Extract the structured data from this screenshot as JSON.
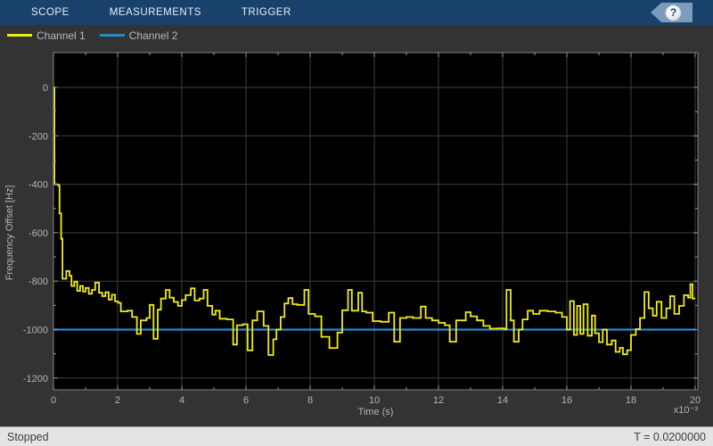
{
  "toolbar": {
    "tabs": [
      {
        "id": "scope",
        "label": "SCOPE"
      },
      {
        "id": "measurements",
        "label": "MEASUREMENTS"
      },
      {
        "id": "trigger",
        "label": "TRIGGER"
      }
    ],
    "help_glyph": "?"
  },
  "legend": {
    "items": [
      {
        "label": "Channel 1",
        "color": "#f1ec16"
      },
      {
        "label": "Channel 2",
        "color": "#2a86cc"
      }
    ]
  },
  "status_bar": {
    "state": "Stopped",
    "time_display": "T = 0.0200000"
  },
  "colors": {
    "toolbar_bg": "#18426b",
    "panel_bg": "#333333",
    "plot_bg": "#000000",
    "grid": "#3e3e3e",
    "axes_box": "#828282",
    "tick": "#9a9a9a",
    "text": "#b4b4b4",
    "channel1": "#f1ec16",
    "channel2": "#2a86cc",
    "status_bg": "#e4e4e4"
  },
  "chart_data": {
    "type": "line",
    "title": "",
    "xlabel": "Time (s)",
    "ylabel": "Frequency Offset [Hz]",
    "x_multiplier_label": "x10⁻³",
    "x_unit_scale": 0.001,
    "xlim_ms": [
      0,
      20
    ],
    "ylim": [
      -1250,
      145
    ],
    "x_major_ticks_ms": [
      0,
      2,
      4,
      6,
      8,
      10,
      12,
      14,
      16,
      18,
      20
    ],
    "x_minor_ticks_ms": [
      1,
      3,
      5,
      7,
      9,
      11,
      13,
      15,
      17,
      19
    ],
    "y_major_ticks": [
      0,
      -200,
      -400,
      -600,
      -800,
      -1000,
      -1200
    ],
    "y_minor_ticks": [
      -100,
      -300,
      -500,
      -700,
      -900,
      -1100
    ],
    "grid": true,
    "legend_position": "top-left",
    "series": [
      {
        "name": "Channel 1",
        "color": "#f1ec16",
        "style": "steps-post",
        "points_t_ms_hz": [
          [
            0,
            0
          ],
          [
            0.03,
            -400
          ],
          [
            0.15,
            -405
          ],
          [
            0.19,
            -520
          ],
          [
            0.24,
            -625
          ],
          [
            0.28,
            -790
          ],
          [
            0.4,
            -758
          ],
          [
            0.5,
            -778
          ],
          [
            0.56,
            -820
          ],
          [
            0.65,
            -802
          ],
          [
            0.74,
            -840
          ],
          [
            0.83,
            -820
          ],
          [
            0.92,
            -843
          ],
          [
            1.0,
            -828
          ],
          [
            1.1,
            -852
          ],
          [
            1.2,
            -836
          ],
          [
            1.3,
            -806
          ],
          [
            1.42,
            -848
          ],
          [
            1.52,
            -862
          ],
          [
            1.62,
            -846
          ],
          [
            1.72,
            -876
          ],
          [
            1.82,
            -856
          ],
          [
            1.92,
            -884
          ],
          [
            2.02,
            -890
          ],
          [
            2.1,
            -925
          ],
          [
            2.3,
            -922
          ],
          [
            2.45,
            -948
          ],
          [
            2.6,
            -1018
          ],
          [
            2.72,
            -962
          ],
          [
            2.9,
            -952
          ],
          [
            3.0,
            -898
          ],
          [
            3.12,
            -1038
          ],
          [
            3.25,
            -918
          ],
          [
            3.35,
            -872
          ],
          [
            3.5,
            -836
          ],
          [
            3.62,
            -868
          ],
          [
            3.75,
            -886
          ],
          [
            3.88,
            -902
          ],
          [
            4.0,
            -878
          ],
          [
            4.12,
            -858
          ],
          [
            4.28,
            -830
          ],
          [
            4.4,
            -880
          ],
          [
            4.55,
            -872
          ],
          [
            4.68,
            -836
          ],
          [
            4.8,
            -902
          ],
          [
            4.95,
            -938
          ],
          [
            5.05,
            -922
          ],
          [
            5.18,
            -955
          ],
          [
            5.4,
            -958
          ],
          [
            5.6,
            -1062
          ],
          [
            5.72,
            -982
          ],
          [
            5.9,
            -978
          ],
          [
            6.05,
            -1086
          ],
          [
            6.2,
            -962
          ],
          [
            6.35,
            -925
          ],
          [
            6.55,
            -985
          ],
          [
            6.7,
            -1105
          ],
          [
            6.85,
            -1040
          ],
          [
            6.95,
            -1000
          ],
          [
            7.08,
            -948
          ],
          [
            7.2,
            -892
          ],
          [
            7.32,
            -870
          ],
          [
            7.45,
            -895
          ],
          [
            7.6,
            -898
          ],
          [
            7.82,
            -836
          ],
          [
            7.95,
            -935
          ],
          [
            8.15,
            -945
          ],
          [
            8.35,
            -1030
          ],
          [
            8.6,
            -1076
          ],
          [
            8.85,
            -1012
          ],
          [
            9.0,
            -920
          ],
          [
            9.18,
            -836
          ],
          [
            9.3,
            -922
          ],
          [
            9.5,
            -848
          ],
          [
            9.62,
            -925
          ],
          [
            9.75,
            -930
          ],
          [
            9.95,
            -965
          ],
          [
            10.2,
            -968
          ],
          [
            10.45,
            -930
          ],
          [
            10.62,
            -1050
          ],
          [
            10.8,
            -952
          ],
          [
            11.0,
            -948
          ],
          [
            11.2,
            -952
          ],
          [
            11.45,
            -905
          ],
          [
            11.6,
            -952
          ],
          [
            11.8,
            -962
          ],
          [
            12.0,
            -972
          ],
          [
            12.2,
            -982
          ],
          [
            12.35,
            -1050
          ],
          [
            12.55,
            -962
          ],
          [
            12.85,
            -928
          ],
          [
            13.0,
            -945
          ],
          [
            13.2,
            -962
          ],
          [
            13.4,
            -985
          ],
          [
            13.6,
            -996
          ],
          [
            13.85,
            -995
          ],
          [
            14.05,
            -998
          ],
          [
            14.12,
            -836
          ],
          [
            14.25,
            -962
          ],
          [
            14.35,
            -1050
          ],
          [
            14.5,
            -1000
          ],
          [
            14.62,
            -958
          ],
          [
            14.78,
            -922
          ],
          [
            14.95,
            -935
          ],
          [
            15.15,
            -922
          ],
          [
            15.4,
            -925
          ],
          [
            15.65,
            -930
          ],
          [
            15.85,
            -948
          ],
          [
            16.0,
            -1000
          ],
          [
            16.1,
            -882
          ],
          [
            16.22,
            -1022
          ],
          [
            16.32,
            -902
          ],
          [
            16.42,
            -1018
          ],
          [
            16.52,
            -895
          ],
          [
            16.65,
            -1025
          ],
          [
            16.78,
            -942
          ],
          [
            16.88,
            -1015
          ],
          [
            17.0,
            -1052
          ],
          [
            17.12,
            -1000
          ],
          [
            17.25,
            -1062
          ],
          [
            17.4,
            -1045
          ],
          [
            17.52,
            -1092
          ],
          [
            17.65,
            -1075
          ],
          [
            17.75,
            -1102
          ],
          [
            17.88,
            -1085
          ],
          [
            18.0,
            -1022
          ],
          [
            18.15,
            -998
          ],
          [
            18.28,
            -952
          ],
          [
            18.42,
            -845
          ],
          [
            18.55,
            -912
          ],
          [
            18.68,
            -942
          ],
          [
            18.8,
            -885
          ],
          [
            18.95,
            -952
          ],
          [
            19.1,
            -912
          ],
          [
            19.22,
            -862
          ],
          [
            19.35,
            -935
          ],
          [
            19.5,
            -902
          ],
          [
            19.65,
            -858
          ],
          [
            19.78,
            -868
          ],
          [
            19.85,
            -812
          ],
          [
            19.92,
            -872
          ],
          [
            20.0,
            -872
          ]
        ]
      },
      {
        "name": "Channel 2",
        "color": "#2a86cc",
        "style": "line",
        "points_t_ms_hz": [
          [
            0,
            -1000
          ],
          [
            20,
            -1000
          ]
        ]
      }
    ]
  }
}
